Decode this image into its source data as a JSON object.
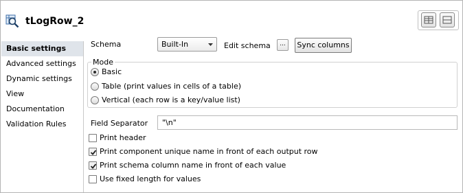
{
  "header": {
    "title": "tLogRow_2",
    "component_icon": "magnifier-table-icon",
    "layout_buttons": [
      {
        "icon": "two-column-layout-icon"
      },
      {
        "icon": "two-row-layout-icon"
      }
    ]
  },
  "sidebar": {
    "items": [
      {
        "label": "Basic settings",
        "active": true
      },
      {
        "label": "Advanced settings",
        "active": false
      },
      {
        "label": "Dynamic settings",
        "active": false
      },
      {
        "label": "View",
        "active": false
      },
      {
        "label": "Documentation",
        "active": false
      },
      {
        "label": "Validation Rules",
        "active": false
      }
    ]
  },
  "schema": {
    "label": "Schema",
    "selected": "Built-In",
    "edit_label": "Edit schema",
    "edit_button": "...",
    "sync_button": "Sync columns"
  },
  "mode": {
    "legend": "Mode",
    "options": [
      {
        "label": "Basic",
        "checked": true
      },
      {
        "label": "Table (print values in cells of a table)",
        "checked": false
      },
      {
        "label": "Vertical (each row is a key/value list)",
        "checked": false
      }
    ]
  },
  "field_separator": {
    "label": "Field Separator",
    "value": "\"\\n\""
  },
  "checkboxes": [
    {
      "label": "Print header",
      "checked": false
    },
    {
      "label": "Print component unique name in front of each output row",
      "checked": true
    },
    {
      "label": "Print schema column name in front of each value",
      "checked": true
    },
    {
      "label": "Use fixed length for values",
      "checked": false
    }
  ],
  "colors": {
    "active_tab_bg": "#dfe4ea",
    "border": "#b4b4b4"
  }
}
